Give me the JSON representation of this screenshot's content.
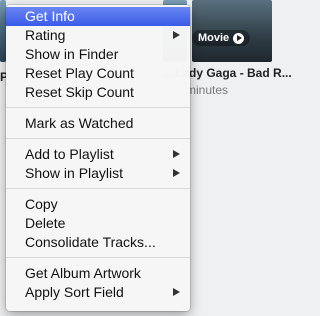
{
  "background": {
    "badge_label": "Movie",
    "title": "...Lady Gaga - Bad R...",
    "subtitle": "minutes",
    "left_edge_text": "P"
  },
  "menu": {
    "groups": [
      [
        {
          "label": "Get Info",
          "selected": true
        },
        {
          "label": "Rating",
          "submenu": true
        },
        {
          "label": "Show in Finder"
        },
        {
          "label": "Reset Play Count"
        },
        {
          "label": "Reset Skip Count"
        }
      ],
      [
        {
          "label": "Mark as Watched"
        }
      ],
      [
        {
          "label": "Add to Playlist",
          "submenu": true
        },
        {
          "label": "Show in Playlist",
          "submenu": true
        }
      ],
      [
        {
          "label": "Copy"
        },
        {
          "label": "Delete"
        },
        {
          "label": "Consolidate Tracks..."
        }
      ],
      [
        {
          "label": "Get Album Artwork"
        },
        {
          "label": "Apply Sort Field",
          "submenu": true
        }
      ]
    ]
  },
  "colors": {
    "selection": "#3a5be9",
    "menu_background": "#f6f6f6"
  }
}
